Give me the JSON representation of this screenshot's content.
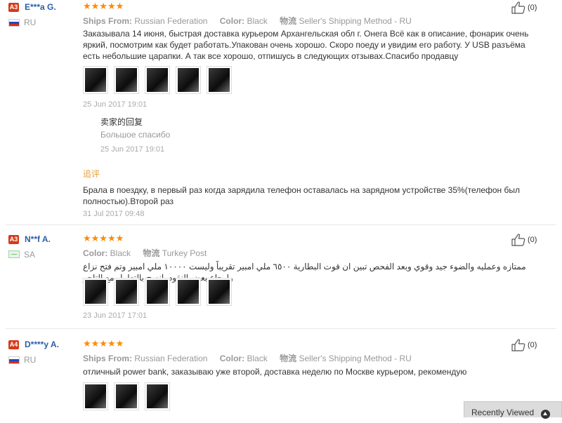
{
  "reviews": [
    {
      "level": "A3",
      "user": "E***a G.",
      "country": "RU",
      "ships_from_label": "Ships From:",
      "ships_from": "Russian Federation",
      "color_label": "Color:",
      "color": "Black",
      "shipping_label": "物流",
      "shipping": "Seller's Shipping Method - RU",
      "text": "Заказывала 14 июня, быстрая доставка курьером Архангельская обл г. Онега Всё как в описание, фонарик очень яркий, посмотрим как будет работать.Упакован очень хорошо. Скоро поеду и увидим его работу. У USB разъёма есть небольшие царапки. А так все хорошо, отпишусь в следующих отзывах.Спасибо продавцу",
      "date": "25 Jun 2017 19:01",
      "helpful": "(0)",
      "reply_title": "卖家的回复",
      "reply_text": "Большое спасибо",
      "reply_date": "25 Jun 2017 19:01",
      "additional_title": "追评",
      "additional_text": "Брала в поездку, в первый раз когда зарядила телефон оставалась на зарядном устройстве 35%(телефон был полностью).Второй раз",
      "additional_date": "31 Jul 2017 09:48"
    },
    {
      "level": "A3",
      "user": "N**f A.",
      "country": "SA",
      "color_label": "Color:",
      "color": "Black",
      "shipping_label": "物流",
      "shipping": "Turkey Post",
      "text": "ممتازه وعمليه والضوء جيد وقوي وبعد الفحص تبين ان قوت البطارية ٦٥٠٠ ملي امبير تقريباً وليست ١٠٠٠٠ ملي امبير وتم فتح نزاع وارجاع بعض النقود .انصح بالتعامل مع التاجر",
      "date": "23 Jun 2017 17:01",
      "helpful": "(0)"
    },
    {
      "level": "A4",
      "user": "D****y A.",
      "country": "RU",
      "ships_from_label": "Ships From:",
      "ships_from": "Russian Federation",
      "color_label": "Color:",
      "color": "Black",
      "shipping_label": "物流",
      "shipping": "Seller's Shipping Method - RU",
      "text": "отличный power bank, заказываю уже второй, доставка неделю по Москве курьером, рекомендую",
      "helpful": "(0)"
    }
  ],
  "stars": "★★★★★",
  "rating_stars": 5,
  "thumb_icon": "thumbs-up-icon",
  "recently_viewed": "Recently Viewed"
}
